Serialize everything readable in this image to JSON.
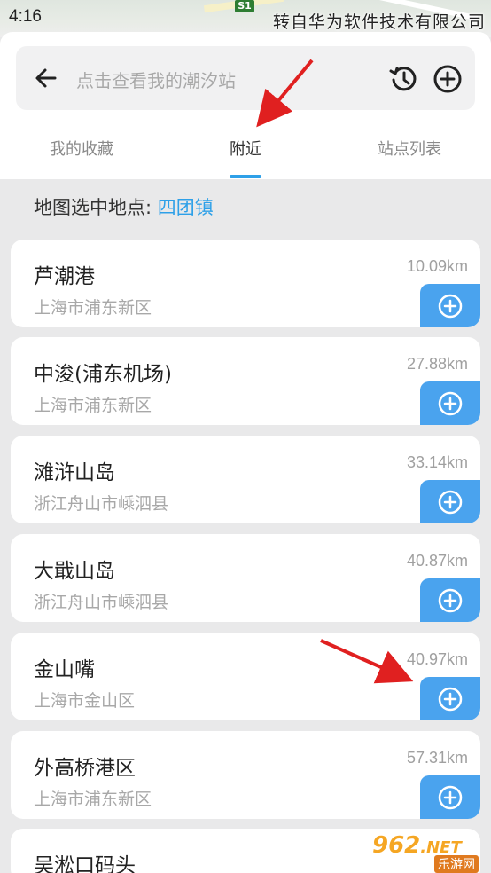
{
  "status_bar": {
    "time": "4:16"
  },
  "map": {
    "badge": "S1"
  },
  "watermark_top": "转自华为软件技术有限公司",
  "search": {
    "placeholder": "点击查看我的潮汐站"
  },
  "tabs": [
    {
      "label": "我的收藏",
      "active": false
    },
    {
      "label": "附近",
      "active": true
    },
    {
      "label": "站点列表",
      "active": false
    }
  ],
  "selected_location": {
    "label": "地图选中地点:",
    "value": "四团镇"
  },
  "stations": [
    {
      "name": "芦潮港",
      "region": "上海市浦东新区",
      "distance": "10.09km"
    },
    {
      "name": "中浚(浦东机场)",
      "region": "上海市浦东新区",
      "distance": "27.88km"
    },
    {
      "name": "滩浒山岛",
      "region": "浙江舟山市嵊泗县",
      "distance": "33.14km"
    },
    {
      "name": "大戢山岛",
      "region": "浙江舟山市嵊泗县",
      "distance": "40.87km"
    },
    {
      "name": "金山嘴",
      "region": "上海市金山区",
      "distance": "40.97km"
    },
    {
      "name": "外高桥港区",
      "region": "上海市浦东新区",
      "distance": "57.31km"
    },
    {
      "name": "吴淞口码头",
      "region": "",
      "distance": ""
    }
  ],
  "logo_watermark": {
    "main": "962",
    "suffix": ".NET",
    "sub": "乐游网"
  },
  "colors": {
    "accent": "#2ea0e8",
    "add_button": "#4aa3ee",
    "annotation": "#e02020"
  },
  "icons": [
    "back-arrow-icon",
    "history-icon",
    "add-circle-icon"
  ]
}
